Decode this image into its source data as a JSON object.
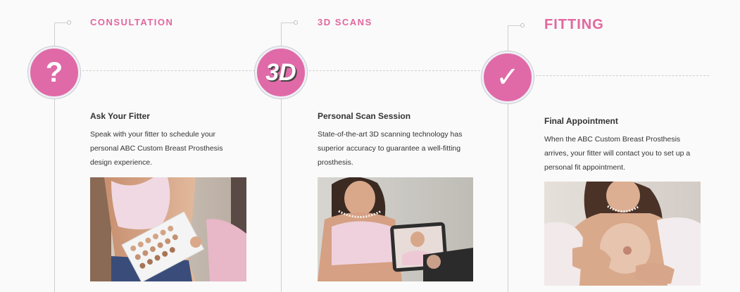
{
  "steps": [
    {
      "title": "Consultation",
      "icon": "question-mark-icon",
      "icon_glyph": "?",
      "subheading": "Ask Your Fitter",
      "description": "Speak with your fitter to schedule your personal ABC Custom Breast Prosthesis design experience.",
      "photo": "photo-fitter-consultation"
    },
    {
      "title": "3D Scans",
      "icon": "3d-icon",
      "icon_glyph": "3D",
      "subheading": "Personal Scan Session",
      "description": "State-of-the-art 3D scanning technology has superior accuracy to guarantee a well-fitting prosthesis.",
      "photo": "photo-tablet-scan"
    },
    {
      "title": "Fitting",
      "icon": "checkmark-icon",
      "icon_glyph": "✓",
      "subheading": "Final Appointment",
      "description": "When the ABC Custom Breast Prosthesis arrives, your fitter will contact you to set up a personal fit appointment.",
      "photo": "photo-prosthesis-fitting"
    }
  ],
  "colors": {
    "accent": "#e2669f",
    "circle": "#e06aa8",
    "line": "#cfcfcf",
    "background": "#fafafa"
  }
}
